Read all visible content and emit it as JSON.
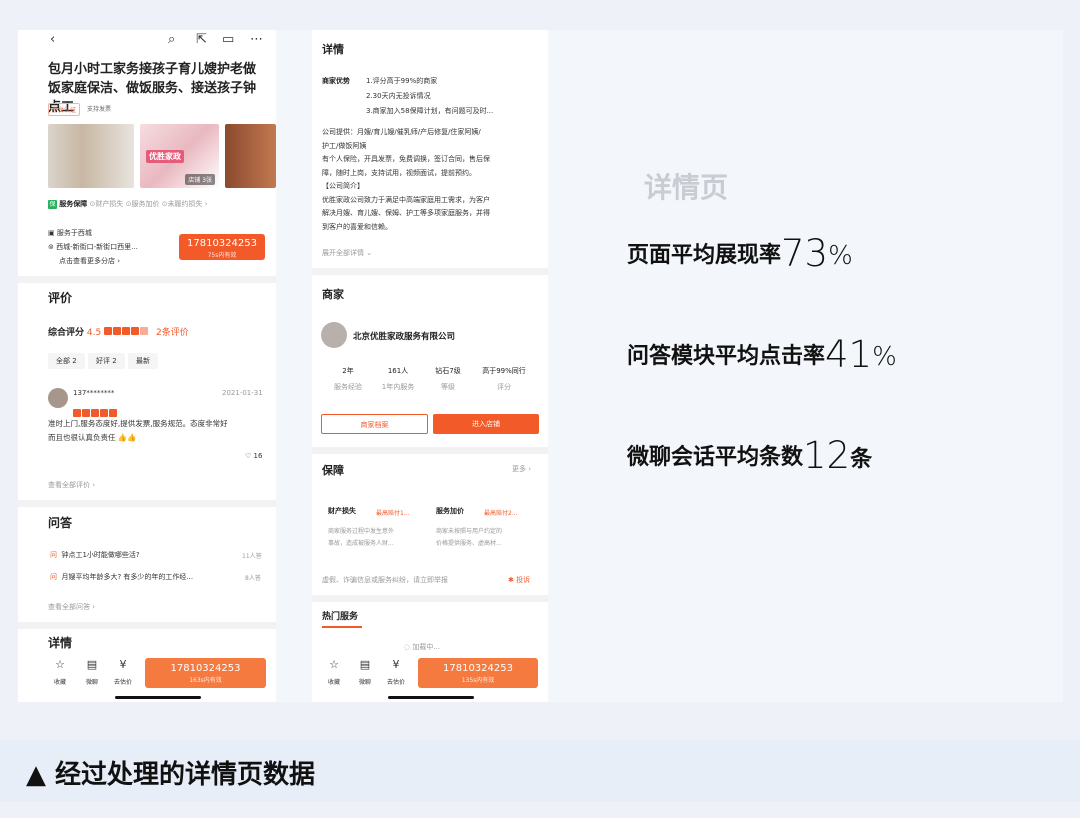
{
  "left_phone": {
    "title": "包月小时工家务接孩子育儿嫂护老做饭家庭保洁、做饭服务、接送孩子钟点工",
    "tag_platform": "平台认证",
    "tag_invoice": "支持发票",
    "img_badge": "店铺 3张",
    "img_overlay": "优胜家政",
    "guarantee": {
      "label": "服务保障",
      "items": [
        "财产损失",
        "服务加价",
        "未履约损失"
      ]
    },
    "service_area": "服务于西城",
    "address": "西城-新街口-新街口西里...",
    "branch_link": "点击查看更多分店",
    "call_number": "17810324253",
    "call_sub": "75s内有效",
    "review_title": "评价",
    "rating_label": "综合评分",
    "rating_value": "4.5",
    "review_count": "2条评价",
    "filters": [
      "全部 2",
      "好评 2",
      "最新"
    ],
    "reviewer": "137********",
    "review_date": "2021-01-31",
    "review_text_1": "准时上门,服务态度好,提供发票,服务规范。态度非常好",
    "review_text_2": "而且也很认真负责任 👍👍",
    "likes": "16",
    "all_reviews": "查看全部评价",
    "qa_title": "问答",
    "qa_items": [
      {
        "q": "钟点工1小时能做哪些活?",
        "meta": "11人答"
      },
      {
        "q": "月嫂平均年龄多大? 有多少的年的工作经...",
        "meta": "8人答"
      }
    ],
    "all_qa": "查看全部问答",
    "detail_title": "详情",
    "bottom": {
      "fav": "收藏",
      "chat": "微聊",
      "eval": "去估价"
    },
    "bottom_call_number": "17810324253",
    "bottom_call_sub": "163s内有效"
  },
  "right_phone": {
    "detail_title": "详情",
    "adv_label": "商家优势",
    "adv_items": [
      "1.评分高于99%的商家",
      "2.30天内无投诉情况",
      "3.商家加入58保障计划，有问题可及时..."
    ],
    "company_lines": [
      "公司提供：月嫂/育儿嫂/催乳师/产后修复/住家阿姨/",
      "护工/做饭阿姨",
      "有个人保险，开具发票，免费调换，签订合同，售后保",
      "障，随时上岗，支持试用，视频面试，提前预约。",
      "【公司简介】",
      "优胜家政公司致力于满足中高端家庭用工需求，为客户",
      "解决月嫂、育儿嫂、保姆、护工等多项家庭服务，并得",
      "到客户的喜爱和信赖。"
    ],
    "expand": "展开全部详情",
    "merchant_title": "商家",
    "merchant_name": "北京优胜家政服务有限公司",
    "merchant_stats": [
      {
        "v": "2年",
        "l": "服务经验"
      },
      {
        "v": "161人",
        "l": "1年内服务"
      },
      {
        "v": "钻石7级",
        "l": "等级"
      },
      {
        "v": "高于99%同行",
        "l": "评分"
      }
    ],
    "btn_archive": "商家档案",
    "btn_store": "进入店铺",
    "guarantee_title": "保障",
    "more": "更多",
    "guar_cols": [
      {
        "title": "财产损失",
        "badge": "最高赔付1...",
        "desc1": "商家服务过程中发生意外",
        "desc2": "事故，造成被服务人财..."
      },
      {
        "title": "服务加价",
        "badge": "最高赔付2...",
        "desc1": "商家未按照与用户约定的",
        "desc2": "价格提供服务、虚高材..."
      }
    ],
    "report_text": "虚假、诈骗信息或服务纠纷，请立即举报",
    "report_btn": "投诉",
    "hot_title": "热门服务",
    "loading": "加载中...",
    "bottom": {
      "fav": "收藏",
      "chat": "微聊",
      "eval": "去估价"
    },
    "bottom_call_number": "17810324253",
    "bottom_call_sub": "135s内有效"
  },
  "stats": {
    "page_label": "详情页",
    "rows": [
      {
        "label": "页面平均展现率",
        "value": "73",
        "unit": "%"
      },
      {
        "label": "问答模块平均点击率",
        "value": "41",
        "unit": "%"
      },
      {
        "label": "微聊会话平均条数",
        "value": "12",
        "unit": "条"
      }
    ]
  },
  "caption": "▲ 经过处理的详情页数据",
  "colors": {
    "accent": "#f25a2a",
    "guarantee_green": "#27b35b"
  }
}
